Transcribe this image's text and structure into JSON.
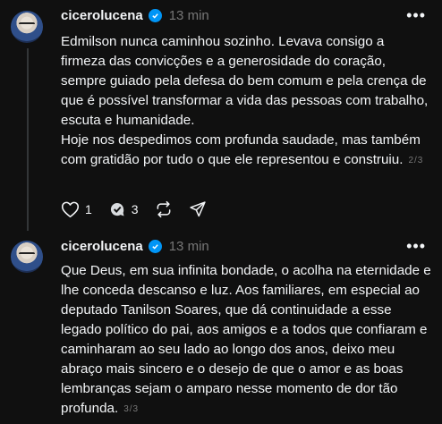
{
  "posts": [
    {
      "username": "cicerolucena",
      "time": "13 min",
      "paragraphs": [
        "Edmilson nunca caminhou sozinho. Levava consigo a firmeza das convicções e a generosidade do coração, sempre guiado pela defesa do bem comum e pela crença de que é possível transformar a vida das pessoas com trabalho, escuta e humanidade.",
        "Hoje nos despedimos com profunda saudade, mas também com gratidão por tudo o que ele representou e construiu."
      ],
      "pager": "2/3",
      "likes": "1",
      "replies": "3"
    },
    {
      "username": "cicerolucena",
      "time": "13 min",
      "paragraphs": [
        "Que Deus, em sua infinita bondade, o acolha na eternidade e lhe conceda descanso e luz. Aos familiares, em especial ao deputado Tanilson Soares, que dá continuidade a esse legado político do pai, aos amigos e a todos que confiaram e caminharam ao seu lado ao longo dos anos, deixo meu abraço mais sincero e o desejo de que o amor e as boas lembranças sejam o amparo nesse momento de dor tão profunda."
      ],
      "pager": "3/3"
    }
  ],
  "icons": {
    "verified": "verified-badge-icon",
    "more": "more-options-icon",
    "like": "heart-icon",
    "reply": "comment-icon",
    "repost": "repost-icon",
    "share": "share-icon"
  },
  "colors": {
    "background": "#101010",
    "text": "#f3f5f7",
    "muted": "#777777",
    "verified": "#0095f6"
  }
}
